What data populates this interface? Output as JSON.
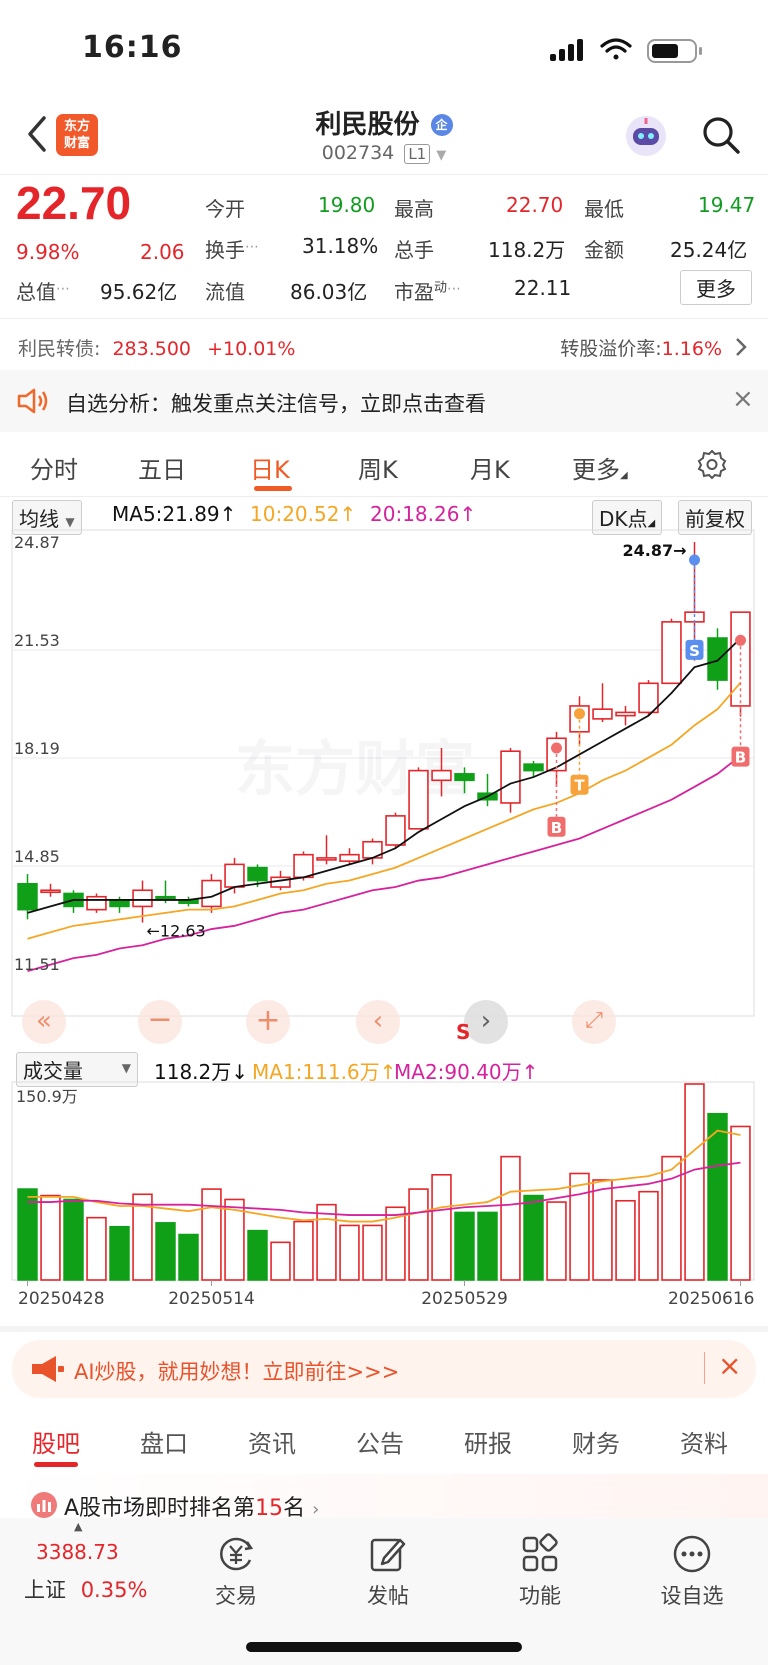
{
  "status": {
    "time": "16:16"
  },
  "header": {
    "logo_line1": "东方",
    "logo_line2": "财富",
    "stock_name": "利民股份",
    "name_tag": "企",
    "stock_code": "002734",
    "level": "L1"
  },
  "quote": {
    "price": "22.70",
    "change_pct": "9.98%",
    "change_amt": "2.06",
    "open_label": "今开",
    "open": "19.80",
    "high_label": "最高",
    "high": "22.70",
    "low_label": "最低",
    "low": "19.47",
    "turnover_label": "换手",
    "turnover": "31.18%",
    "volume_label": "总手",
    "volume": "118.2万",
    "amount_label": "金额",
    "amount": "25.24亿",
    "mktcap_label": "总值",
    "mktcap": "95.62亿",
    "float_label": "流值",
    "float": "86.03亿",
    "pe_label": "市盈",
    "pe_sup": "动",
    "pe": "22.11",
    "more_label": "更多"
  },
  "bond": {
    "label": "利民转债:",
    "price": "283.500",
    "change": "+10.01%",
    "premium_label": "转股溢价率:",
    "premium": "1.16%"
  },
  "analysis": {
    "text": "自选分析：触发重点关注信号，立即点击查看"
  },
  "ktabs": [
    "分时",
    "五日",
    "日K",
    "周K",
    "月K",
    "更多"
  ],
  "legend": {
    "ma_select": "均线",
    "ma5": "MA5:21.89",
    "ma10": "10:20.52",
    "ma20": "20:18.26",
    "dk": "DK点",
    "adjust": "前复权"
  },
  "vol_legend": {
    "select": "成交量",
    "value": "118.2万",
    "ma1": "MA1:111.6万",
    "ma2": "MA2:90.40万"
  },
  "chart_data": {
    "type": "candlestick",
    "y_ticks": [
      "24.87",
      "21.53",
      "18.19",
      "14.85",
      "11.51"
    ],
    "ylim": [
      11.51,
      24.87
    ],
    "annotations": {
      "high": "24.87→",
      "low": "←12.63",
      "watermark": "东方财富"
    },
    "dates": [
      "20250428",
      "20250514",
      "20250529",
      "20250616"
    ],
    "candles": [
      {
        "o": 14.3,
        "c": 13.5,
        "h": 14.6,
        "l": 13.2
      },
      {
        "o": 14.1,
        "c": 14.1,
        "h": 14.3,
        "l": 13.9
      },
      {
        "o": 14.0,
        "c": 13.6,
        "h": 14.1,
        "l": 13.4
      },
      {
        "o": 13.5,
        "c": 13.9,
        "h": 14.0,
        "l": 13.4
      },
      {
        "o": 13.8,
        "c": 13.6,
        "h": 13.9,
        "l": 13.4
      },
      {
        "o": 13.6,
        "c": 14.1,
        "h": 14.4,
        "l": 13.1
      },
      {
        "o": 13.9,
        "c": 13.8,
        "h": 14.4,
        "l": 13.7
      },
      {
        "o": 13.8,
        "c": 13.7,
        "h": 13.9,
        "l": 13.6
      },
      {
        "o": 13.6,
        "c": 14.4,
        "h": 14.6,
        "l": 13.4
      },
      {
        "o": 14.2,
        "c": 14.9,
        "h": 15.1,
        "l": 14.0
      },
      {
        "o": 14.8,
        "c": 14.4,
        "h": 14.9,
        "l": 14.2
      },
      {
        "o": 14.2,
        "c": 14.5,
        "h": 14.7,
        "l": 14.1
      },
      {
        "o": 14.5,
        "c": 15.2,
        "h": 15.3,
        "l": 14.4
      },
      {
        "o": 15.1,
        "c": 15.1,
        "h": 15.8,
        "l": 14.9
      },
      {
        "o": 15.0,
        "c": 15.2,
        "h": 15.4,
        "l": 14.9
      },
      {
        "o": 15.1,
        "c": 15.6,
        "h": 15.7,
        "l": 14.9
      },
      {
        "o": 15.5,
        "c": 16.4,
        "h": 16.5,
        "l": 15.4
      },
      {
        "o": 16.0,
        "c": 17.8,
        "h": 17.9,
        "l": 16.0
      },
      {
        "o": 17.5,
        "c": 17.8,
        "h": 18.5,
        "l": 17.0
      },
      {
        "o": 17.7,
        "c": 17.5,
        "h": 17.9,
        "l": 17.1
      },
      {
        "o": 17.1,
        "c": 16.9,
        "h": 17.7,
        "l": 16.7
      },
      {
        "o": 16.8,
        "c": 18.4,
        "h": 18.5,
        "l": 16.5
      },
      {
        "o": 18.0,
        "c": 17.8,
        "h": 18.1,
        "l": 17.6
      },
      {
        "o": 17.8,
        "c": 18.8,
        "h": 19.0,
        "l": 17.3
      },
      {
        "o": 19.0,
        "c": 19.8,
        "h": 20.1,
        "l": 18.6
      },
      {
        "o": 19.4,
        "c": 19.7,
        "h": 20.5,
        "l": 19.3
      },
      {
        "o": 19.5,
        "c": 19.6,
        "h": 19.8,
        "l": 19.2
      },
      {
        "o": 19.6,
        "c": 20.5,
        "h": 20.6,
        "l": 19.5
      },
      {
        "o": 20.5,
        "c": 22.4,
        "h": 22.5,
        "l": 20.5
      },
      {
        "o": 22.4,
        "c": 22.7,
        "h": 24.87,
        "l": 21.2
      },
      {
        "o": 21.9,
        "c": 20.6,
        "h": 22.2,
        "l": 20.3
      },
      {
        "o": 19.8,
        "c": 22.7,
        "h": 22.7,
        "l": 19.47
      }
    ],
    "ma5": [
      13.4,
      13.6,
      13.8,
      13.8,
      13.8,
      13.8,
      13.8,
      13.8,
      13.9,
      14.2,
      14.3,
      14.4,
      14.5,
      14.7,
      14.9,
      15.1,
      15.4,
      15.9,
      16.3,
      16.7,
      17.0,
      17.4,
      17.6,
      17.9,
      18.3,
      18.7,
      19.1,
      19.5,
      20.2,
      21.0,
      21.2,
      21.89
    ],
    "ma10": [
      12.6,
      12.8,
      13.0,
      13.1,
      13.2,
      13.3,
      13.4,
      13.5,
      13.5,
      13.6,
      13.8,
      14.0,
      14.1,
      14.3,
      14.4,
      14.6,
      14.8,
      15.1,
      15.4,
      15.7,
      16.0,
      16.3,
      16.6,
      16.8,
      17.1,
      17.5,
      17.8,
      18.2,
      18.6,
      19.2,
      19.7,
      20.52
    ],
    "ma20": [
      11.6,
      11.8,
      12.0,
      12.1,
      12.3,
      12.4,
      12.6,
      12.7,
      12.9,
      13.0,
      13.2,
      13.4,
      13.5,
      13.7,
      13.9,
      14.1,
      14.2,
      14.4,
      14.5,
      14.7,
      14.9,
      15.1,
      15.3,
      15.5,
      15.7,
      16.0,
      16.3,
      16.6,
      16.9,
      17.3,
      17.7,
      18.26
    ],
    "markers": [
      {
        "i": 23,
        "label": "B",
        "color": "#f06d6d"
      },
      {
        "i": 24,
        "label": "T",
        "color": "#f7a23a"
      },
      {
        "i": 29,
        "label": "S",
        "color": "#5a8ff0"
      },
      {
        "i": 31,
        "label": "B",
        "color": "#f06d6d"
      }
    ],
    "volume": {
      "ymax_label": "150.9万",
      "ymax": 150.9,
      "values": [
        70,
        65,
        62,
        48,
        41,
        66,
        44,
        35,
        70,
        62,
        38,
        29,
        45,
        58,
        42,
        42,
        56,
        70,
        81,
        52,
        52,
        95,
        65,
        60,
        82,
        77,
        61,
        68,
        95,
        150.9,
        128,
        118.2
      ],
      "ma1": [
        64,
        64,
        64,
        60,
        57,
        57,
        55,
        53,
        56,
        54,
        51,
        48,
        46,
        47,
        45,
        45,
        48,
        52,
        56,
        58,
        60,
        68,
        69,
        70,
        73,
        76,
        78,
        80,
        85,
        100,
        115,
        111.6
      ],
      "ma2": [
        60,
        60,
        61,
        61,
        59,
        58,
        58,
        58,
        57,
        56,
        55,
        54,
        52,
        51,
        50,
        50,
        50,
        52,
        54,
        56,
        57,
        58,
        60,
        63,
        66,
        70,
        72,
        74,
        78,
        85,
        88,
        90.4
      ]
    }
  },
  "toolbar": {
    "s_mark": "S"
  },
  "ai_banner": {
    "text": "AI炒股，就用妙想！立即前往>>>"
  },
  "bottom_tabs": [
    "股吧",
    "盘口",
    "资讯",
    "公告",
    "研报",
    "财务",
    "资料"
  ],
  "ranking": {
    "prefix": "A股市场即时排名第",
    "rank": "15",
    "suffix": "名"
  },
  "index": {
    "value": "3388.73",
    "name": "上证",
    "change": "0.35%"
  },
  "footer_nav": [
    "交易",
    "发帖",
    "功能",
    "设自选"
  ]
}
